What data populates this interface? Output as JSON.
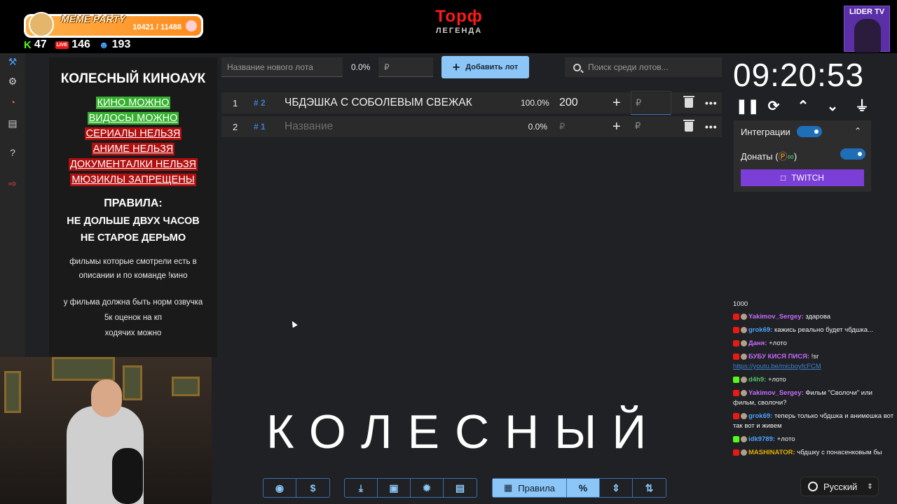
{
  "overlay": {
    "meme_title": "MEME PARTY",
    "meme_count": "10421 / 11488",
    "stat_kick": "47",
    "stat_live": "146",
    "stat_viewers": "193",
    "live_badge": "LIVE",
    "logo_main": "Торф",
    "logo_sub": "ЛЕГЕНДА",
    "channel_label": "LIDER TV"
  },
  "rules": {
    "title": "КОЛЕСНЫЙ КИНОАУК",
    "items": [
      {
        "text": "КИНО МОЖНО",
        "color": "#35b12f"
      },
      {
        "text": "ВИДОСЫ МОЖНО",
        "color": "#35b12f"
      },
      {
        "text": "СЕРИАЛЫ НЕЛЬЗЯ",
        "color": "#b20f0f"
      },
      {
        "text": "АНИМЕ НЕЛЬЗЯ",
        "color": "#b20f0f"
      },
      {
        "text": "ДОКУМЕНТАЛКИ НЕЛЬЗЯ",
        "color": "#b20f0f"
      },
      {
        "text": "МЮЗИКЛЫ ЗАПРЕЩЕНЫ",
        "color": "#b20f0f"
      }
    ],
    "heading": "ПРАВИЛА:",
    "bold1": "НЕ ДОЛЬШЕ ДВУХ ЧАСОВ",
    "bold2": "НЕ СТАРОЕ ДЕРЬМО",
    "small1": "фильмы которые смотрели есть в описании и по команде !кино",
    "small2": "у фильма должна быть норм озвучка",
    "small3": "5к оценок на кп",
    "small4": "ходячих можно"
  },
  "controls": {
    "lot_placeholder": "Название нового лота",
    "percent": "0.0%",
    "rub_placeholder": "₽",
    "add_label": "Добавить лот",
    "search_placeholder": "Поиск среди лотов..."
  },
  "lots": [
    {
      "num": "1",
      "id": "# 2",
      "name": "ЧБДЭШКА С СОБОЛЕВЫМ СВЕЖАК",
      "pct": "100.0%",
      "amount": "200",
      "input": "₽"
    },
    {
      "num": "2",
      "id": "# 1",
      "name": "Название",
      "pct": "0.0%",
      "amount": "₽",
      "input": "₽"
    }
  ],
  "big_word": "КОЛЕСНЫЙ",
  "toolbar": {
    "rules_label": "Правила"
  },
  "timer": {
    "time": "09:20:53",
    "integrations_label": "Интеграции",
    "donations_label": "Донаты (",
    "donations_suffix": ")",
    "twitch_label": "TWITCH"
  },
  "chat": {
    "count": "1000",
    "messages": [
      {
        "nick": "Yakimov_Sergey:",
        "text": " здарова",
        "color": "#c66bff"
      },
      {
        "nick": "grok69:",
        "text": " кажись реально будет чбдшка...",
        "color": "#4aa3ff"
      },
      {
        "nick": "Даня:",
        "text": " +лото",
        "color": "#c66bff"
      },
      {
        "nick": "БУБУ КИСЯ ПИСЯ:",
        "text": " !sr",
        "color": "#c66bff"
      },
      {
        "nick": "",
        "text": "https://youtu.be/micboyfcFCM",
        "color": "#3b7fd1"
      },
      {
        "nick": "d4h9:",
        "text": " +лото",
        "color": "#53c26b"
      },
      {
        "nick": "Yakimov_Sergey:",
        "text": " Фильм \"Сволочи\" или фильм, сволочи?",
        "color": "#c66bff"
      },
      {
        "nick": "grok69:",
        "text": " теперь только чбдшка и анимешка вот так вот и живем",
        "color": "#4aa3ff"
      },
      {
        "nick": "idk9789:",
        "text": " +лото",
        "color": "#4aa3ff"
      },
      {
        "nick": "MASHINATOR:",
        "text": " чбдшку с понасенковым бы",
        "color": "#e0b000"
      }
    ]
  },
  "language": "Русский"
}
